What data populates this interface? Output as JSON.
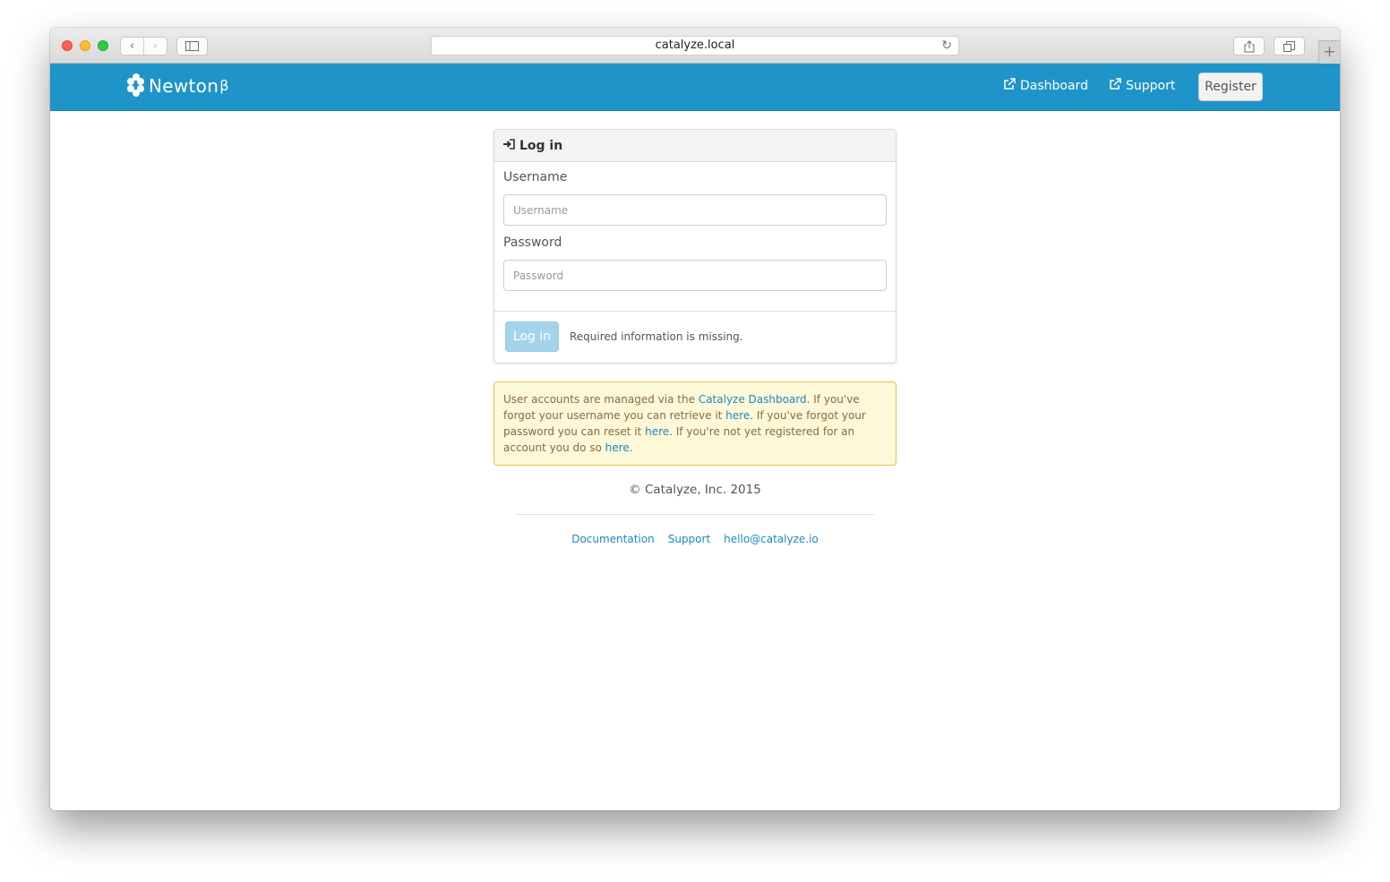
{
  "browser": {
    "url": "catalyze.local",
    "back_icon": "chevron-left-icon",
    "forward_icon": "chevron-right-icon",
    "sidebar_icon": "sidebar-icon",
    "reload_icon": "reload-icon",
    "share_icon": "share-icon",
    "tabs_icon": "tabs-icon",
    "newtab_label": "+"
  },
  "navbar": {
    "brand": "Newton",
    "brand_suffix": "β",
    "links": [
      {
        "label": "Dashboard",
        "icon": "external-link-icon"
      },
      {
        "label": "Support",
        "icon": "external-link-icon"
      }
    ],
    "register_label": "Register",
    "color": "#1e94c9"
  },
  "login": {
    "heading": "Log in",
    "heading_icon": "sign-in-icon",
    "username_label": "Username",
    "username_placeholder": "Username",
    "username_value": "",
    "password_label": "Password",
    "password_placeholder": "Password",
    "password_value": "",
    "submit_label": "Log in",
    "status": "Required information is missing."
  },
  "notice": {
    "t1": "User accounts are managed via the ",
    "link1": "Catalyze Dashboard",
    "t2": ". If you've forgot your username you can retrieve it ",
    "link2": "here",
    "t3": ". If you've forgot your password you can reset it ",
    "link3": "here",
    "t4": ". If you're not yet registered for an account you do so ",
    "link4": "here",
    "t5": "."
  },
  "footer": {
    "copyright": "© Catalyze, Inc. 2015",
    "links": [
      "Documentation",
      "Support",
      "hello@catalyze.io"
    ]
  }
}
